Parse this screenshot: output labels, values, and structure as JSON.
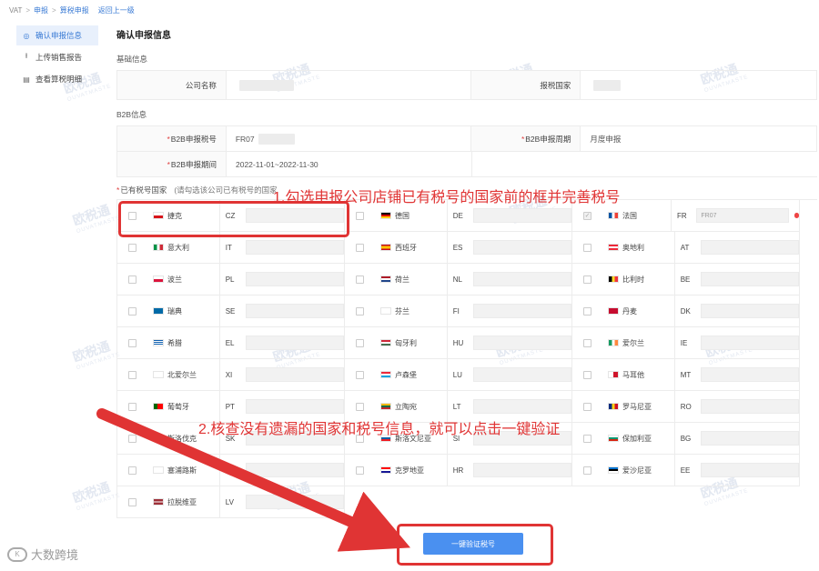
{
  "breadcrumb": [
    "VAT",
    "申报",
    "算税申报",
    "返回上一级"
  ],
  "sidebar": {
    "items": [
      {
        "label": "确认申报信息",
        "icon": "circle-icon",
        "active": true
      },
      {
        "label": "上传销售报告",
        "icon": "upload-icon",
        "active": false
      },
      {
        "label": "查看算税明细",
        "icon": "document-icon",
        "active": false
      }
    ]
  },
  "main": {
    "title": "确认申报信息",
    "basic": {
      "heading": "基础信息",
      "company_label": "公司名称",
      "country_label": "报税国家"
    },
    "b2b": {
      "heading": "B2B信息",
      "tax_no_label": "B2B申报税号",
      "tax_no_value": "FR07",
      "cycle_label": "B2B申报周期",
      "cycle_value": "月度申报",
      "period_label": "B2B申报期间",
      "period_value": "2022-11-01~2022-11-30"
    },
    "countries_heading": "已有税号国家",
    "countries_hint": "(请勾选该公司已有税号的国家",
    "countries": [
      {
        "name": "捷克",
        "code": "CZ",
        "flag": "cz"
      },
      {
        "name": "德国",
        "code": "DE",
        "flag": "de"
      },
      {
        "name": "法国",
        "code": "FR",
        "flag": "fr",
        "checked": true,
        "value": "FR07"
      },
      {
        "name": "意大利",
        "code": "IT",
        "flag": "it"
      },
      {
        "name": "西班牙",
        "code": "ES",
        "flag": "es"
      },
      {
        "name": "奥地利",
        "code": "AT",
        "flag": "at"
      },
      {
        "name": "波兰",
        "code": "PL",
        "flag": "pl"
      },
      {
        "name": "荷兰",
        "code": "NL",
        "flag": "nl"
      },
      {
        "name": "比利时",
        "code": "BE",
        "flag": "be"
      },
      {
        "name": "瑞典",
        "code": "SE",
        "flag": "se"
      },
      {
        "name": "芬兰",
        "code": "FI",
        "flag": "fi"
      },
      {
        "name": "丹麦",
        "code": "DK",
        "flag": "dk"
      },
      {
        "name": "希腊",
        "code": "EL",
        "flag": "gr"
      },
      {
        "name": "匈牙利",
        "code": "HU",
        "flag": "hu"
      },
      {
        "name": "爱尔兰",
        "code": "IE",
        "flag": "ie"
      },
      {
        "name": "北爱尔兰",
        "code": "XI",
        "flag": "xi"
      },
      {
        "name": "卢森堡",
        "code": "LU",
        "flag": "lu"
      },
      {
        "name": "马耳他",
        "code": "MT",
        "flag": "mt"
      },
      {
        "name": "葡萄牙",
        "code": "PT",
        "flag": "pt"
      },
      {
        "name": "立陶宛",
        "code": "LT",
        "flag": "lt"
      },
      {
        "name": "罗马尼亚",
        "code": "RO",
        "flag": "ro"
      },
      {
        "name": "斯洛伐克",
        "code": "SK",
        "flag": "sk"
      },
      {
        "name": "斯洛文尼亚",
        "code": "SI",
        "flag": "si"
      },
      {
        "name": "保加利亚",
        "code": "BG",
        "flag": "bg"
      },
      {
        "name": "塞浦路斯",
        "code": "CY",
        "flag": "cy"
      },
      {
        "name": "克罗地亚",
        "code": "HR",
        "flag": "hr"
      },
      {
        "name": "爱沙尼亚",
        "code": "EE",
        "flag": "ee"
      },
      {
        "name": "拉脱维亚",
        "code": "LV",
        "flag": "lv"
      }
    ],
    "verify_button": "一键验证税号"
  },
  "annotations": {
    "step1": "1.勾选申报公司店铺已有税号的国家前的框并完善税号",
    "step2": "2.核查没有遗漏的国家和税号信息，就可以点击一键验证"
  },
  "watermark": {
    "text": "欧税通",
    "sub": "OUVATMASTE"
  },
  "footer_logo": "大数跨境",
  "colors": {
    "accent": "#4a90f0",
    "annotation": "#e03434"
  }
}
